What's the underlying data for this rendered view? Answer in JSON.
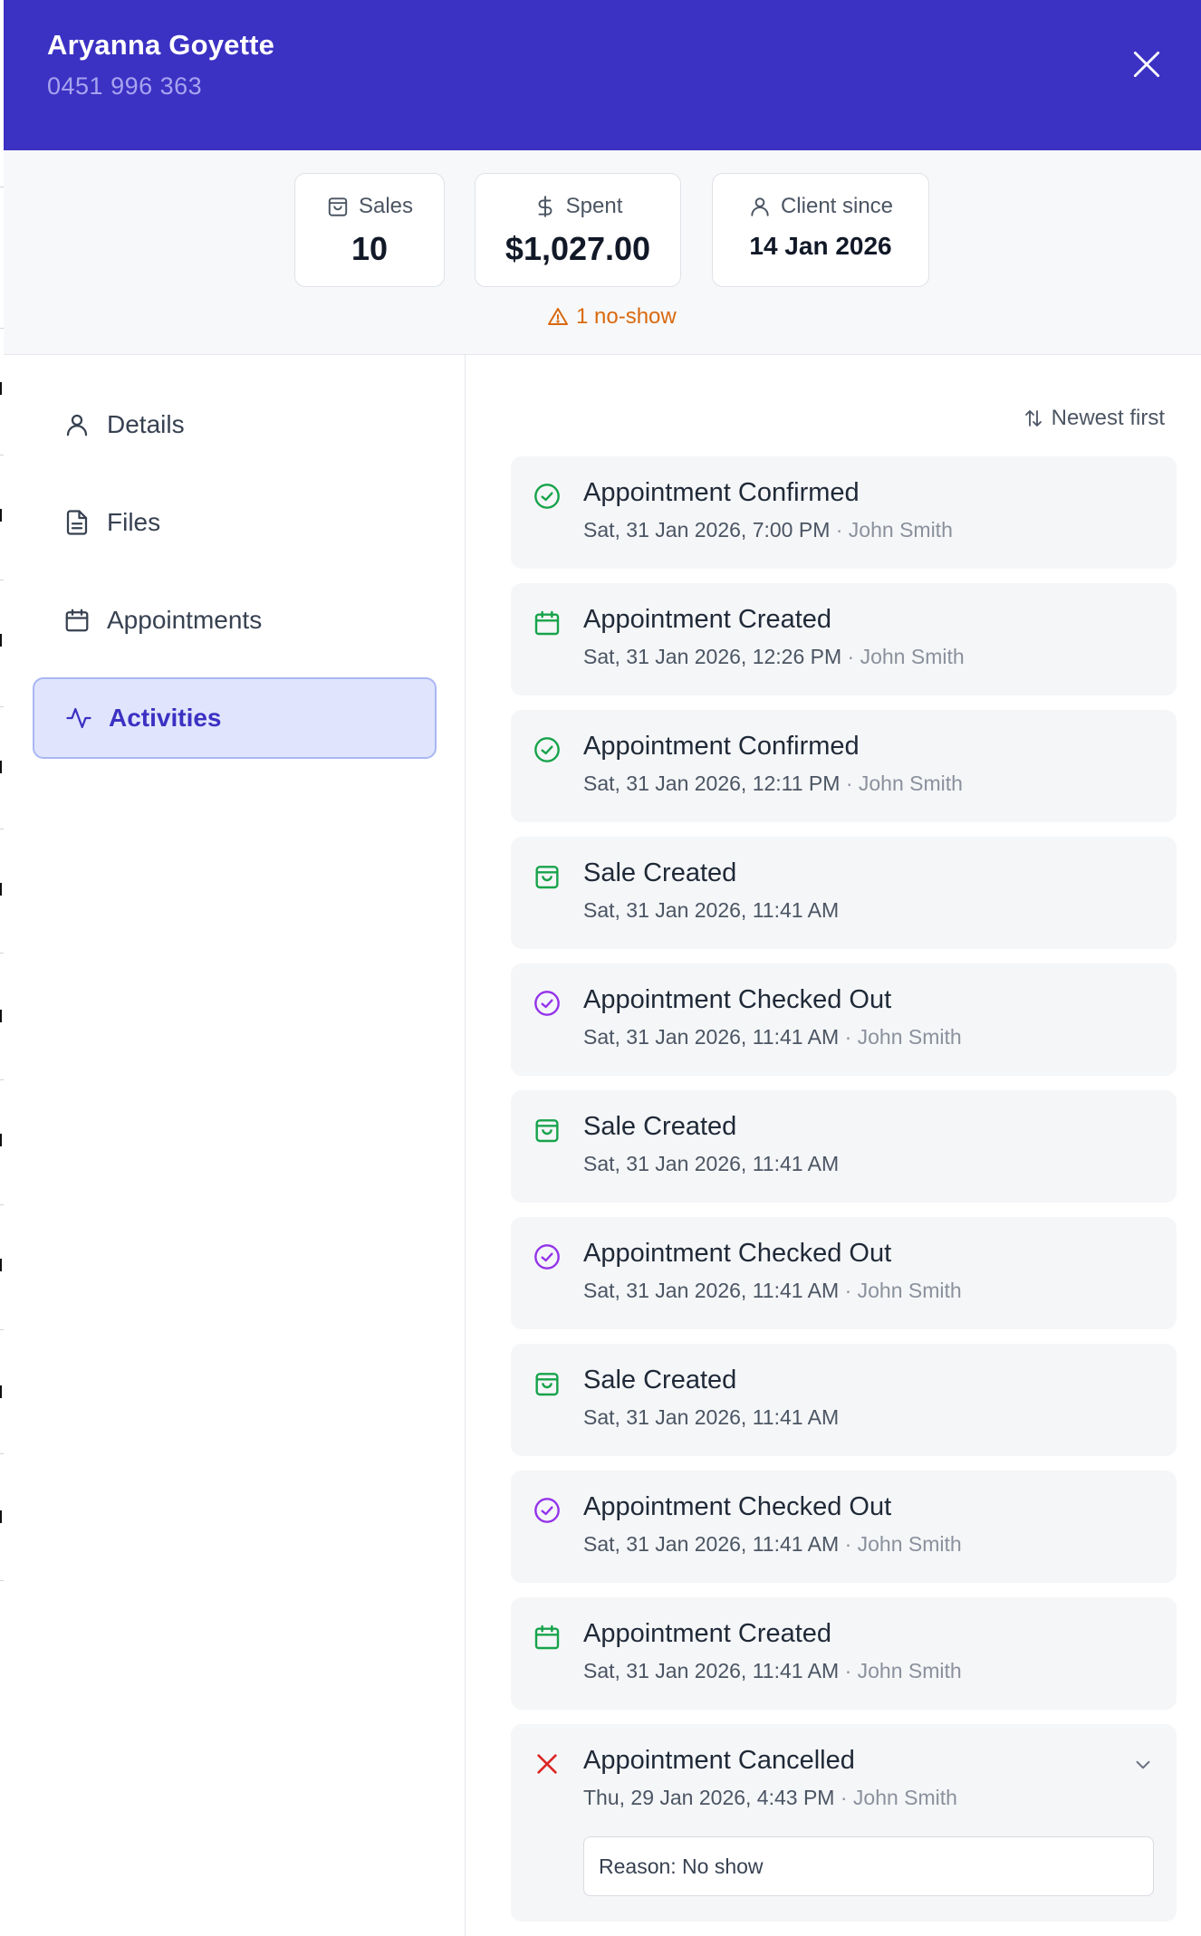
{
  "header": {
    "client_name": "Aryanna Goyette",
    "phone": "0451 996 363",
    "background_color": "#3b31c3"
  },
  "stats": {
    "sales": {
      "label": "Sales",
      "value": "10",
      "icon": "shopping-bag-icon"
    },
    "spent": {
      "label": "Spent",
      "value": "$1,027.00",
      "icon": "dollar-icon"
    },
    "client_since": {
      "label": "Client since",
      "value": "14 Jan 2026",
      "icon": "user-icon"
    },
    "noshow": "1 no-show"
  },
  "sidebar": {
    "items": [
      {
        "label": "Details",
        "icon": "user-icon",
        "active": false
      },
      {
        "label": "Files",
        "icon": "file-icon",
        "active": false
      },
      {
        "label": "Appointments",
        "icon": "calendar-icon",
        "active": false
      },
      {
        "label": "Activities",
        "icon": "activity-icon",
        "active": true
      }
    ]
  },
  "feed": {
    "sort_label": "Newest first",
    "activities": [
      {
        "title": "Appointment Confirmed",
        "date": "Sat, 31 Jan 2026, 7:00 PM",
        "by": "· John Smith",
        "icon": "check-circle-icon",
        "color": "#16a34a"
      },
      {
        "title": "Appointment Created",
        "date": "Sat, 31 Jan 2026, 12:26 PM",
        "by": "· John Smith",
        "icon": "calendar-icon",
        "color": "#16a34a"
      },
      {
        "title": "Appointment Confirmed",
        "date": "Sat, 31 Jan 2026, 12:11 PM",
        "by": "· John Smith",
        "icon": "check-circle-icon",
        "color": "#16a34a"
      },
      {
        "title": "Sale Created",
        "date": "Sat, 31 Jan 2026, 11:41 AM",
        "by": "",
        "icon": "shopping-bag-icon",
        "color": "#16a34a"
      },
      {
        "title": "Appointment Checked Out",
        "date": "Sat, 31 Jan 2026, 11:41 AM",
        "by": "· John Smith",
        "icon": "check-circle-icon",
        "color": "#9333ea"
      },
      {
        "title": "Sale Created",
        "date": "Sat, 31 Jan 2026, 11:41 AM",
        "by": "",
        "icon": "shopping-bag-icon",
        "color": "#16a34a"
      },
      {
        "title": "Appointment Checked Out",
        "date": "Sat, 31 Jan 2026, 11:41 AM",
        "by": "· John Smith",
        "icon": "check-circle-icon",
        "color": "#9333ea"
      },
      {
        "title": "Sale Created",
        "date": "Sat, 31 Jan 2026, 11:41 AM",
        "by": "",
        "icon": "shopping-bag-icon",
        "color": "#16a34a"
      },
      {
        "title": "Appointment Checked Out",
        "date": "Sat, 31 Jan 2026, 11:41 AM",
        "by": "· John Smith",
        "icon": "check-circle-icon",
        "color": "#9333ea"
      },
      {
        "title": "Appointment Created",
        "date": "Sat, 31 Jan 2026, 11:41 AM",
        "by": "· John Smith",
        "icon": "calendar-icon",
        "color": "#16a34a"
      },
      {
        "title": "Appointment Cancelled",
        "date": "Thu, 29 Jan 2026, 4:43 PM",
        "by": "· John Smith",
        "icon": "x-icon",
        "color": "#dc2626",
        "reason": "Reason: No show"
      }
    ]
  }
}
